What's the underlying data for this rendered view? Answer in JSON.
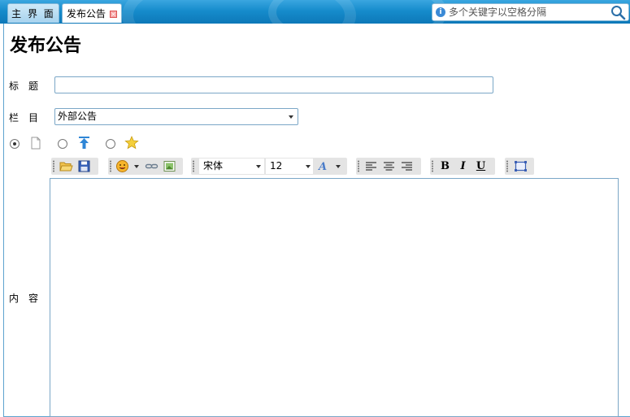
{
  "tabs": [
    {
      "label": "主 界 面",
      "active": false
    },
    {
      "label": "发布公告",
      "active": true,
      "closable": true
    }
  ],
  "search": {
    "placeholder": "多个关键字以空格分隔",
    "icon": "search-icon"
  },
  "page": {
    "title": "发布公告"
  },
  "form": {
    "title_label": "标　题",
    "title_value": "",
    "column_label": "栏　目",
    "column_value": "外部公告",
    "content_label": "内　容",
    "post_type_options": [
      {
        "icon": "document-icon",
        "selected": true
      },
      {
        "icon": "pin-top-icon",
        "selected": false
      },
      {
        "icon": "star-icon",
        "selected": false
      }
    ]
  },
  "toolbar": {
    "font_family": "宋体",
    "font_size": "12",
    "buttons": [
      "open-folder-icon",
      "save-icon",
      "emoticon-icon",
      "link-icon",
      "image-icon",
      "font-color-icon",
      "align-left-icon",
      "align-center-icon",
      "align-right-icon",
      "bold-button",
      "italic-button",
      "underline-button",
      "fullscreen-icon"
    ],
    "bold_label": "B",
    "italic_label": "I",
    "underline_label": "U"
  },
  "colors": {
    "accent": "#168ccc",
    "border": "#7ba7c7"
  }
}
